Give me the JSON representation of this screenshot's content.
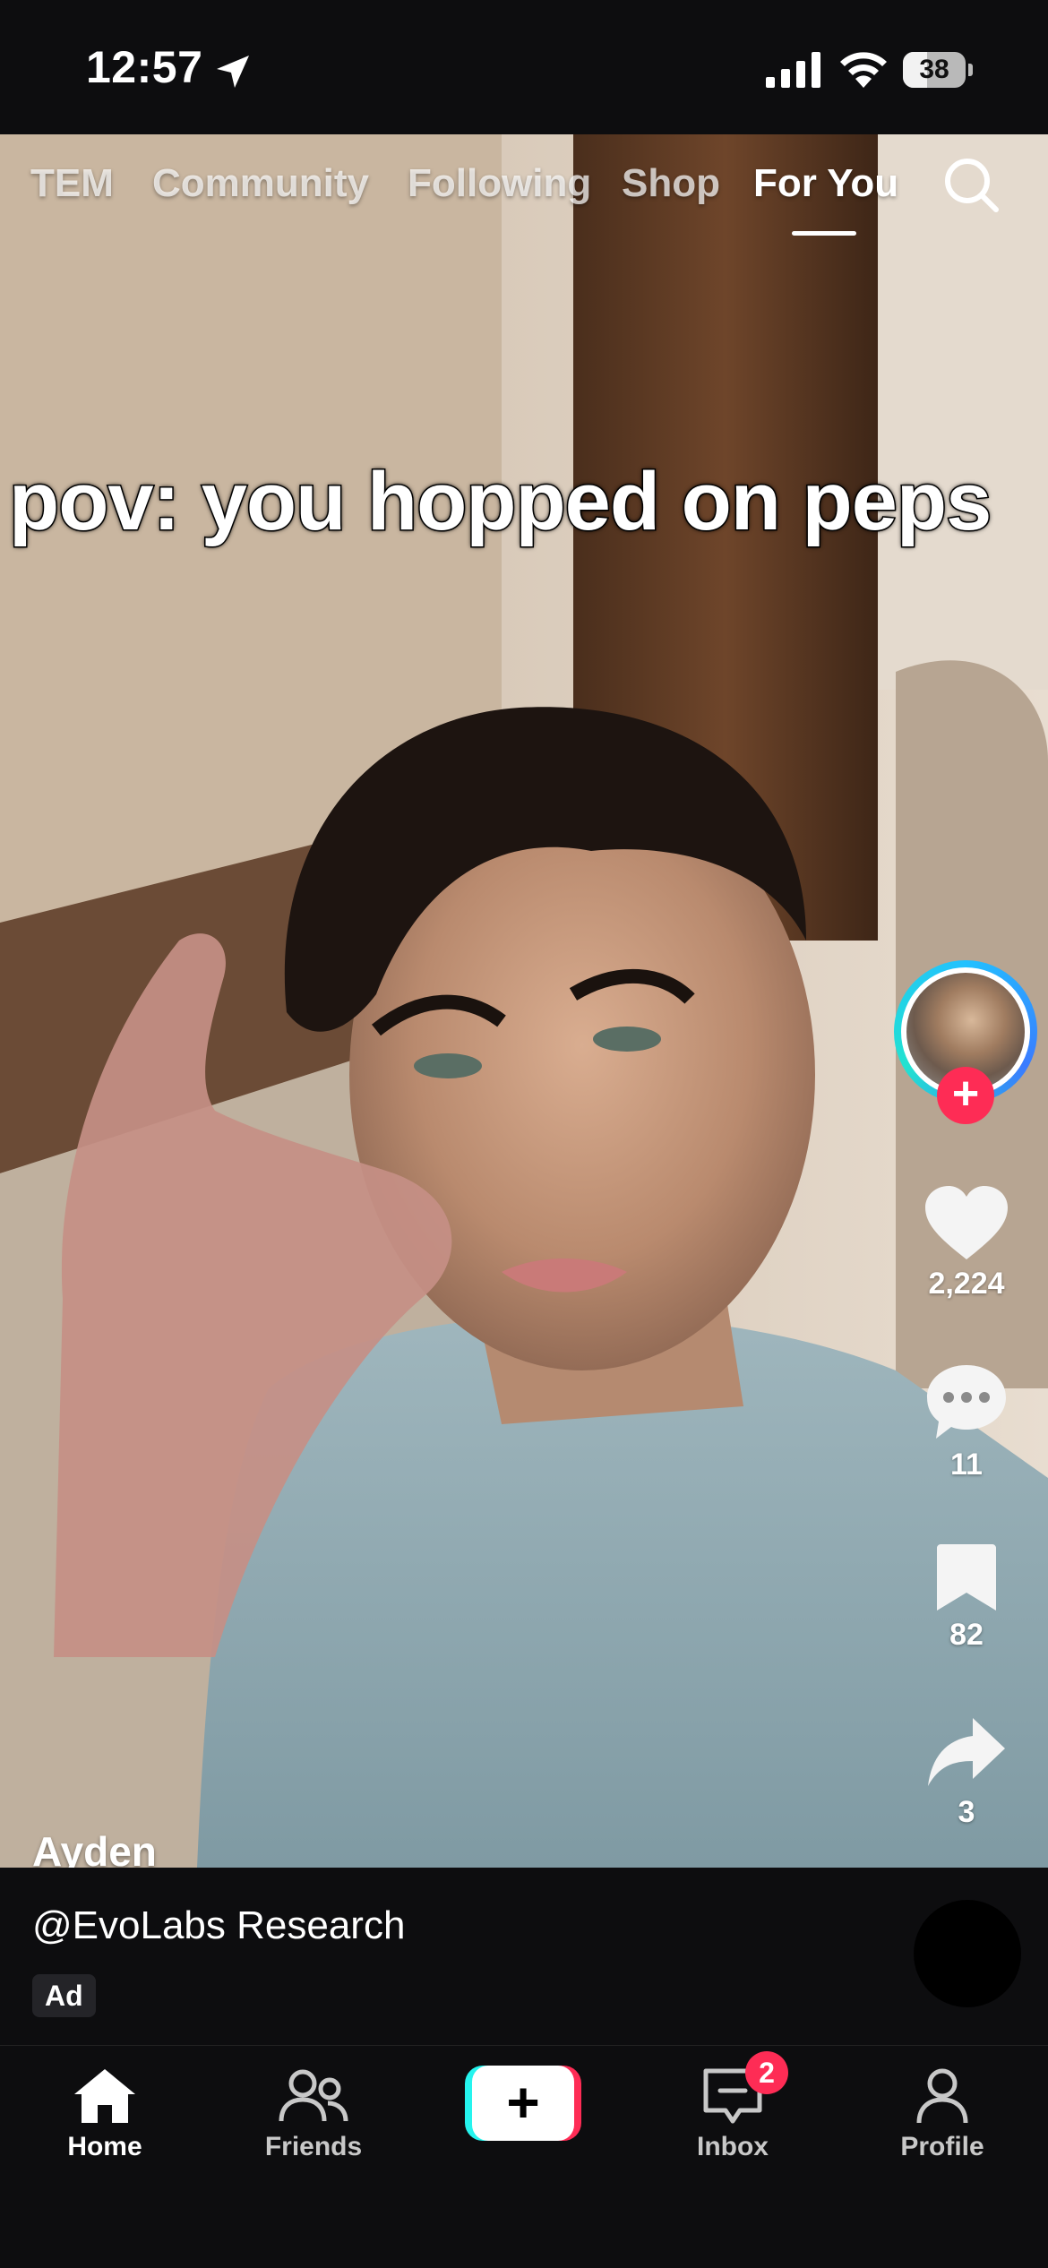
{
  "status_bar": {
    "time": "12:57",
    "battery_level": "38",
    "battery_fraction": 0.38
  },
  "top_tabs": {
    "items": [
      "TEM",
      "Community",
      "Following",
      "Shop",
      "For You"
    ],
    "active": "For You"
  },
  "video": {
    "overlay_text": "pov: you hopped on peps",
    "creator_name": "Ayden"
  },
  "actions": {
    "likes": "2,224",
    "comments": "11",
    "saves": "82",
    "shares": "3",
    "follow_symbol": "+"
  },
  "ad": {
    "handle": "@EvoLabs Research",
    "badge": "Ad"
  },
  "bottom_nav": {
    "home": "Home",
    "friends": "Friends",
    "create_symbol": "+",
    "inbox": "Inbox",
    "inbox_badge": "2",
    "profile": "Profile"
  },
  "colors": {
    "accent_red": "#fe2c55",
    "accent_cyan": "#25f4ee",
    "background": "#0d0d0f"
  },
  "icons": [
    "location-arrow-icon",
    "signal-icon",
    "wifi-icon",
    "battery-icon",
    "search-icon",
    "heart-icon",
    "comment-icon",
    "bookmark-icon",
    "share-icon",
    "home-icon",
    "friends-icon",
    "inbox-icon",
    "profile-icon"
  ]
}
